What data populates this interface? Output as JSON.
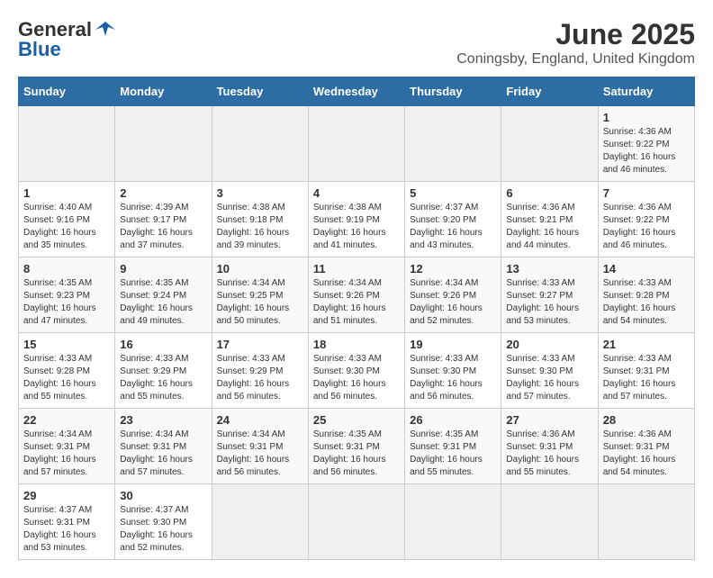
{
  "header": {
    "logo_general": "General",
    "logo_blue": "Blue",
    "month_year": "June 2025",
    "location": "Coningsby, England, United Kingdom"
  },
  "calendar": {
    "days_of_week": [
      "Sunday",
      "Monday",
      "Tuesday",
      "Wednesday",
      "Thursday",
      "Friday",
      "Saturday"
    ],
    "weeks": [
      [
        {
          "day": "",
          "empty": true
        },
        {
          "day": "",
          "empty": true
        },
        {
          "day": "",
          "empty": true
        },
        {
          "day": "",
          "empty": true
        },
        {
          "day": "",
          "empty": true
        },
        {
          "day": "",
          "empty": true
        },
        {
          "day": "1",
          "sunrise": "Sunrise: 4:36 AM",
          "sunset": "Sunset: 9:22 PM",
          "daylight": "Daylight: 16 hours and 46 minutes."
        }
      ],
      [
        {
          "day": "1",
          "sunrise": "Sunrise: 4:40 AM",
          "sunset": "Sunset: 9:16 PM",
          "daylight": "Daylight: 16 hours and 35 minutes."
        },
        {
          "day": "2",
          "sunrise": "Sunrise: 4:39 AM",
          "sunset": "Sunset: 9:17 PM",
          "daylight": "Daylight: 16 hours and 37 minutes."
        },
        {
          "day": "3",
          "sunrise": "Sunrise: 4:38 AM",
          "sunset": "Sunset: 9:18 PM",
          "daylight": "Daylight: 16 hours and 39 minutes."
        },
        {
          "day": "4",
          "sunrise": "Sunrise: 4:38 AM",
          "sunset": "Sunset: 9:19 PM",
          "daylight": "Daylight: 16 hours and 41 minutes."
        },
        {
          "day": "5",
          "sunrise": "Sunrise: 4:37 AM",
          "sunset": "Sunset: 9:20 PM",
          "daylight": "Daylight: 16 hours and 43 minutes."
        },
        {
          "day": "6",
          "sunrise": "Sunrise: 4:36 AM",
          "sunset": "Sunset: 9:21 PM",
          "daylight": "Daylight: 16 hours and 44 minutes."
        },
        {
          "day": "7",
          "sunrise": "Sunrise: 4:36 AM",
          "sunset": "Sunset: 9:22 PM",
          "daylight": "Daylight: 16 hours and 46 minutes."
        }
      ],
      [
        {
          "day": "8",
          "sunrise": "Sunrise: 4:35 AM",
          "sunset": "Sunset: 9:23 PM",
          "daylight": "Daylight: 16 hours and 47 minutes."
        },
        {
          "day": "9",
          "sunrise": "Sunrise: 4:35 AM",
          "sunset": "Sunset: 9:24 PM",
          "daylight": "Daylight: 16 hours and 49 minutes."
        },
        {
          "day": "10",
          "sunrise": "Sunrise: 4:34 AM",
          "sunset": "Sunset: 9:25 PM",
          "daylight": "Daylight: 16 hours and 50 minutes."
        },
        {
          "day": "11",
          "sunrise": "Sunrise: 4:34 AM",
          "sunset": "Sunset: 9:26 PM",
          "daylight": "Daylight: 16 hours and 51 minutes."
        },
        {
          "day": "12",
          "sunrise": "Sunrise: 4:34 AM",
          "sunset": "Sunset: 9:26 PM",
          "daylight": "Daylight: 16 hours and 52 minutes."
        },
        {
          "day": "13",
          "sunrise": "Sunrise: 4:33 AM",
          "sunset": "Sunset: 9:27 PM",
          "daylight": "Daylight: 16 hours and 53 minutes."
        },
        {
          "day": "14",
          "sunrise": "Sunrise: 4:33 AM",
          "sunset": "Sunset: 9:28 PM",
          "daylight": "Daylight: 16 hours and 54 minutes."
        }
      ],
      [
        {
          "day": "15",
          "sunrise": "Sunrise: 4:33 AM",
          "sunset": "Sunset: 9:28 PM",
          "daylight": "Daylight: 16 hours and 55 minutes."
        },
        {
          "day": "16",
          "sunrise": "Sunrise: 4:33 AM",
          "sunset": "Sunset: 9:29 PM",
          "daylight": "Daylight: 16 hours and 55 minutes."
        },
        {
          "day": "17",
          "sunrise": "Sunrise: 4:33 AM",
          "sunset": "Sunset: 9:29 PM",
          "daylight": "Daylight: 16 hours and 56 minutes."
        },
        {
          "day": "18",
          "sunrise": "Sunrise: 4:33 AM",
          "sunset": "Sunset: 9:30 PM",
          "daylight": "Daylight: 16 hours and 56 minutes."
        },
        {
          "day": "19",
          "sunrise": "Sunrise: 4:33 AM",
          "sunset": "Sunset: 9:30 PM",
          "daylight": "Daylight: 16 hours and 56 minutes."
        },
        {
          "day": "20",
          "sunrise": "Sunrise: 4:33 AM",
          "sunset": "Sunset: 9:30 PM",
          "daylight": "Daylight: 16 hours and 57 minutes."
        },
        {
          "day": "21",
          "sunrise": "Sunrise: 4:33 AM",
          "sunset": "Sunset: 9:31 PM",
          "daylight": "Daylight: 16 hours and 57 minutes."
        }
      ],
      [
        {
          "day": "22",
          "sunrise": "Sunrise: 4:34 AM",
          "sunset": "Sunset: 9:31 PM",
          "daylight": "Daylight: 16 hours and 57 minutes."
        },
        {
          "day": "23",
          "sunrise": "Sunrise: 4:34 AM",
          "sunset": "Sunset: 9:31 PM",
          "daylight": "Daylight: 16 hours and 57 minutes."
        },
        {
          "day": "24",
          "sunrise": "Sunrise: 4:34 AM",
          "sunset": "Sunset: 9:31 PM",
          "daylight": "Daylight: 16 hours and 56 minutes."
        },
        {
          "day": "25",
          "sunrise": "Sunrise: 4:35 AM",
          "sunset": "Sunset: 9:31 PM",
          "daylight": "Daylight: 16 hours and 56 minutes."
        },
        {
          "day": "26",
          "sunrise": "Sunrise: 4:35 AM",
          "sunset": "Sunset: 9:31 PM",
          "daylight": "Daylight: 16 hours and 55 minutes."
        },
        {
          "day": "27",
          "sunrise": "Sunrise: 4:36 AM",
          "sunset": "Sunset: 9:31 PM",
          "daylight": "Daylight: 16 hours and 55 minutes."
        },
        {
          "day": "28",
          "sunrise": "Sunrise: 4:36 AM",
          "sunset": "Sunset: 9:31 PM",
          "daylight": "Daylight: 16 hours and 54 minutes."
        }
      ],
      [
        {
          "day": "29",
          "sunrise": "Sunrise: 4:37 AM",
          "sunset": "Sunset: 9:31 PM",
          "daylight": "Daylight: 16 hours and 53 minutes."
        },
        {
          "day": "30",
          "sunrise": "Sunrise: 4:37 AM",
          "sunset": "Sunset: 9:30 PM",
          "daylight": "Daylight: 16 hours and 52 minutes."
        },
        {
          "day": "",
          "empty": true
        },
        {
          "day": "",
          "empty": true
        },
        {
          "day": "",
          "empty": true
        },
        {
          "day": "",
          "empty": true
        },
        {
          "day": "",
          "empty": true
        }
      ]
    ]
  }
}
